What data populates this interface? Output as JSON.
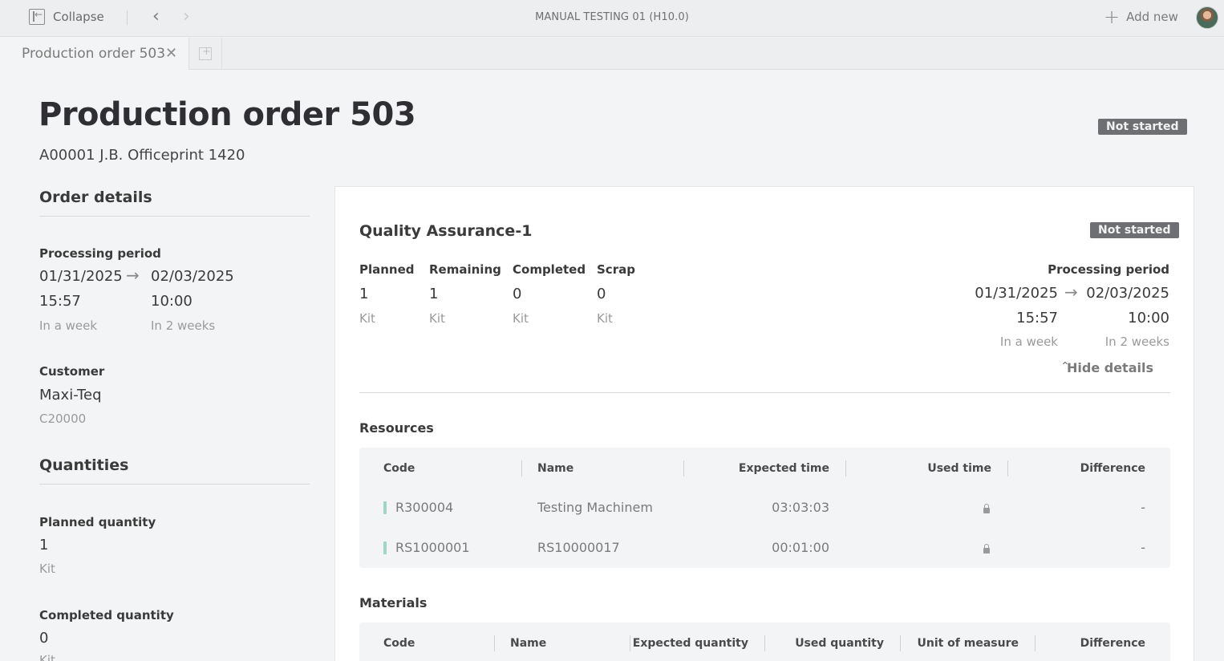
{
  "topbar": {
    "collapse_label": "Collapse",
    "app_title": "MANUAL TESTING 01 (H10.0)",
    "add_new_label": "Add new"
  },
  "tabs": [
    {
      "label": "Production order 503"
    }
  ],
  "header": {
    "title": "Production order 503",
    "subtitle": "A00001 J.B. Officeprint 1420",
    "status": "Not started"
  },
  "order_details": {
    "heading": "Order details",
    "processing_label": "Processing period",
    "start_date": "01/31/2025",
    "start_time": "15:57",
    "start_rel": "In a week",
    "end_date": "02/03/2025",
    "end_time": "10:00",
    "end_rel": "In 2 weeks",
    "customer_label": "Customer",
    "customer_name": "Maxi-Teq",
    "customer_code": "C20000"
  },
  "quantities": {
    "heading": "Quantities",
    "planned_label": "Planned quantity",
    "planned_value": "1",
    "planned_unit": "Kit",
    "completed_label": "Completed quantity",
    "completed_value": "0",
    "completed_unit": "Kit"
  },
  "operation": {
    "title": "Quality Assurance-1",
    "status": "Not started",
    "planned_label": "Planned",
    "planned_value": "1",
    "planned_unit": "Kit",
    "remaining_label": "Remaining",
    "remaining_value": "1",
    "remaining_unit": "Kit",
    "completed_label": "Completed",
    "completed_value": "0",
    "completed_unit": "Kit",
    "scrap_label": "Scrap",
    "scrap_value": "0",
    "scrap_unit": "Kit",
    "processing_label": "Processing period",
    "start_date": "01/31/2025",
    "start_time": "15:57",
    "start_rel": "In a week",
    "end_date": "02/03/2025",
    "end_time": "10:00",
    "end_rel": "In 2 weeks",
    "hide_details_label": "Hide details"
  },
  "resources": {
    "heading": "Resources",
    "columns": [
      "Code",
      "Name",
      "Expected time",
      "Used time",
      "Difference"
    ],
    "rows": [
      {
        "code": "R300004",
        "name": "Testing Machinem",
        "expected": "03:03:03",
        "difference": "-"
      },
      {
        "code": "RS1000001",
        "name": "RS10000017",
        "expected": "00:01:00",
        "difference": "-"
      }
    ]
  },
  "materials": {
    "heading": "Materials",
    "columns": [
      "Code",
      "Name",
      "Expected quantity",
      "Used quantity",
      "Unit of measure",
      "Difference"
    ]
  }
}
